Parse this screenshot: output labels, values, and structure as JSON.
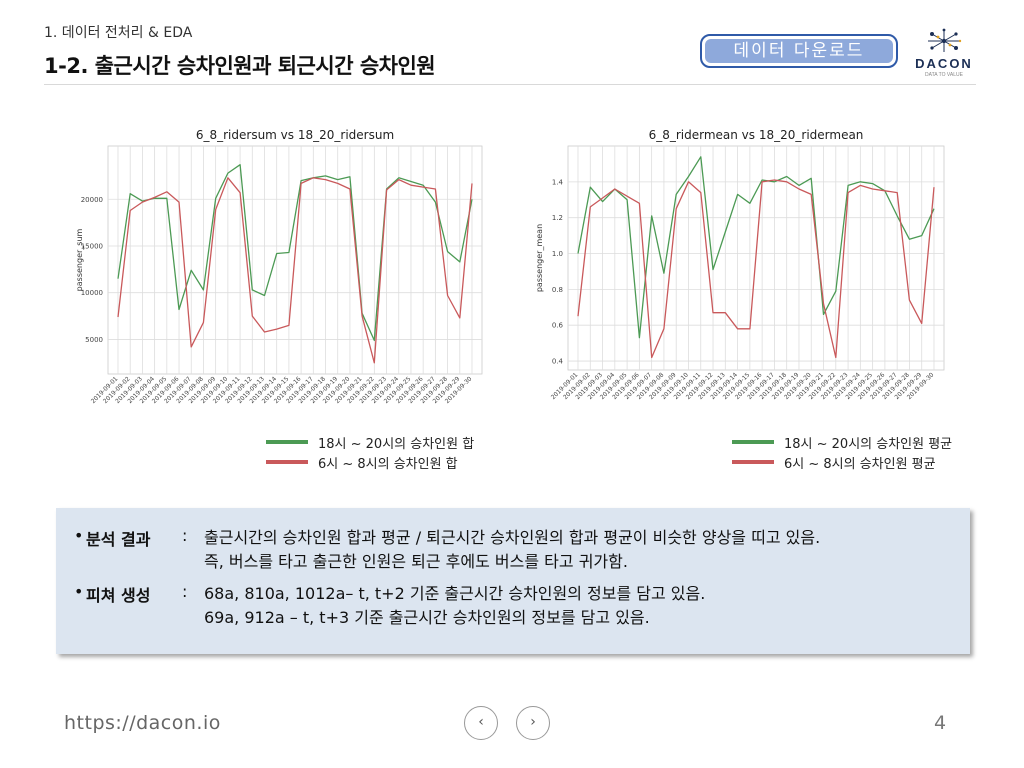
{
  "header": {
    "section": "1. 데이터 전처리 & EDA",
    "title": "1-2. 출근시간 승차인원과 퇴근시간 승차인원",
    "download_label": "데이터 다운로드",
    "logo_name": "DACON",
    "logo_tagline": "DATA TO VALUE"
  },
  "colors": {
    "green": "#4c9a54",
    "red": "#c9595b",
    "button_border": "#2f5aa8",
    "button_fill": "#8ea9db",
    "summary_bg": "#dce5f0"
  },
  "chart_data": [
    {
      "type": "line",
      "title": "6_8_ridersum vs 18_20_ridersum",
      "xlabel": "",
      "ylabel": "passenger_sum",
      "x": [
        "2019-09-01",
        "2019-09-02",
        "2019-09-03",
        "2019-09-04",
        "2019-09-05",
        "2019-09-06",
        "2019-09-07",
        "2019-09-08",
        "2019-09-09",
        "2019-09-10",
        "2019-09-11",
        "2019-09-12",
        "2019-09-13",
        "2019-09-14",
        "2019-09-15",
        "2019-09-16",
        "2019-09-17",
        "2019-09-18",
        "2019-09-19",
        "2019-09-20",
        "2019-09-21",
        "2019-09-22",
        "2019-09-23",
        "2019-09-24",
        "2019-09-25",
        "2019-09-26",
        "2019-09-27",
        "2019-09-28",
        "2019-09-29",
        "2019-09-30"
      ],
      "yticks": [
        5000,
        10000,
        15000,
        20000
      ],
      "ylim": [
        1300,
        25700
      ],
      "grid": true,
      "legend_position": "below-right",
      "series": [
        {
          "name": "18시 ~ 20시의 승차인원 합",
          "color": "#4c9a54",
          "values": [
            11500,
            20600,
            19800,
            20100,
            20100,
            8200,
            12400,
            10300,
            20100,
            22800,
            23700,
            10300,
            9700,
            14200,
            14300,
            22000,
            22300,
            22500,
            22100,
            22400,
            7800,
            4900,
            21100,
            22300,
            21900,
            21500,
            19700,
            14400,
            13300,
            20000
          ]
        },
        {
          "name": "6시 ~ 8시의 승차인원 합",
          "color": "#c9595b",
          "values": [
            7400,
            18800,
            19700,
            20200,
            20800,
            19700,
            4200,
            6800,
            18900,
            22300,
            20700,
            7500,
            5800,
            6100,
            6500,
            21700,
            22300,
            22100,
            21700,
            21100,
            7500,
            2500,
            21000,
            22100,
            21500,
            21300,
            21100,
            9700,
            7300,
            21700
          ]
        }
      ]
    },
    {
      "type": "line",
      "title": "6_8_ridermean vs 18_20_ridermean",
      "xlabel": "",
      "ylabel": "passenger_mean",
      "x": [
        "2019-09-01",
        "2019-09-02",
        "2019-09-03",
        "2019-09-04",
        "2019-09-05",
        "2019-09-06",
        "2019-09-07",
        "2019-09-08",
        "2019-09-09",
        "2019-09-10",
        "2019-09-11",
        "2019-09-12",
        "2019-09-13",
        "2019-09-14",
        "2019-09-15",
        "2019-09-16",
        "2019-09-17",
        "2019-09-18",
        "2019-09-19",
        "2019-09-20",
        "2019-09-21",
        "2019-09-22",
        "2019-09-23",
        "2019-09-24",
        "2019-09-25",
        "2019-09-26",
        "2019-09-27",
        "2019-09-28",
        "2019-09-29",
        "2019-09-30"
      ],
      "yticks": [
        0.4,
        0.6,
        0.8,
        1.0,
        1.2,
        1.4
      ],
      "ylim": [
        0.35,
        1.6
      ],
      "grid": true,
      "legend_position": "below-right",
      "series": [
        {
          "name": "18시 ~ 20시의 승차인원 평균",
          "color": "#4c9a54",
          "values": [
            1.0,
            1.37,
            1.29,
            1.36,
            1.3,
            0.53,
            1.21,
            0.89,
            1.33,
            1.43,
            1.54,
            0.91,
            1.12,
            1.33,
            1.28,
            1.41,
            1.4,
            1.43,
            1.38,
            1.42,
            0.66,
            0.79,
            1.38,
            1.4,
            1.39,
            1.35,
            1.21,
            1.08,
            1.1,
            1.25
          ]
        },
        {
          "name": "6시 ~ 8시의 승차인원 평균",
          "color": "#c9595b",
          "values": [
            0.65,
            1.26,
            1.31,
            1.36,
            1.32,
            1.28,
            0.42,
            0.58,
            1.25,
            1.4,
            1.34,
            0.67,
            0.67,
            0.58,
            0.58,
            1.4,
            1.41,
            1.4,
            1.36,
            1.33,
            0.72,
            0.42,
            1.34,
            1.38,
            1.36,
            1.35,
            1.34,
            0.74,
            0.61,
            1.37
          ]
        }
      ]
    }
  ],
  "summary": {
    "analysis_key": "분석 결과",
    "analysis_lines": [
      "출근시간의 승차인원 합과 평균 / 퇴근시간 승차인원의 합과 평균이 비슷한 양상을 띠고 있음.",
      "즉, 버스를 타고 출근한 인원은 퇴근 후에도 버스를 타고 귀가함."
    ],
    "feature_key": "피쳐 생성",
    "feature_lines": [
      "68a, 810a, 1012a– t, t+2 기준 출근시간 승차인원의 정보를 담고 있음.",
      "69a, 912a – t, t+3 기준 출근시간 승차인원의 정보를 담고 있음."
    ]
  },
  "footer": {
    "url": "https://dacon.io",
    "page": "4",
    "prev_icon": "chevron-left",
    "next_icon": "chevron-right"
  }
}
